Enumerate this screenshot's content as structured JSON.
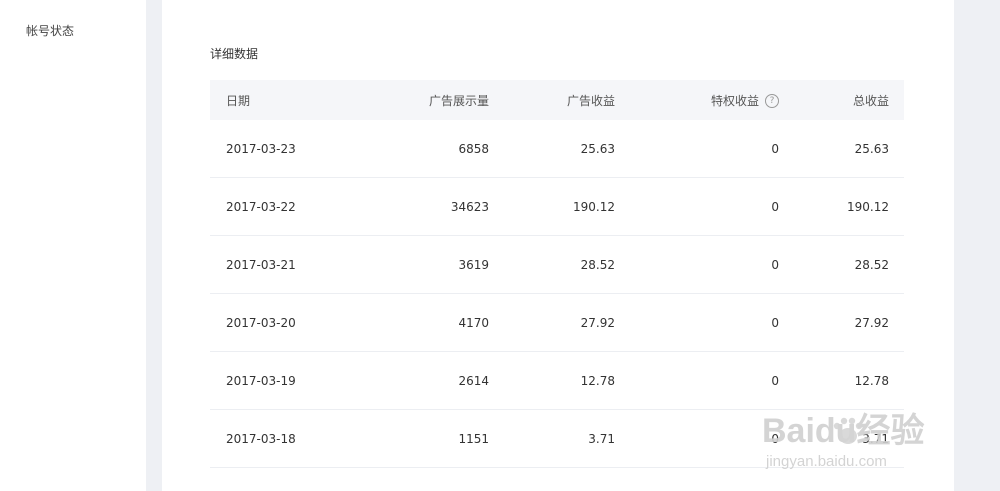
{
  "sidebar": {
    "items": [
      {
        "label": "帐号状态"
      }
    ]
  },
  "main": {
    "section_title": "详细数据",
    "table": {
      "headers": {
        "date": "日期",
        "impressions": "广告展示量",
        "ad_revenue": "广告收益",
        "privilege_revenue": "特权收益",
        "total_revenue": "总收益"
      },
      "rows": [
        {
          "date": "2017-03-23",
          "impressions": "6858",
          "ad_revenue": "25.63",
          "privilege_revenue": "0",
          "total_revenue": "25.63"
        },
        {
          "date": "2017-03-22",
          "impressions": "34623",
          "ad_revenue": "190.12",
          "privilege_revenue": "0",
          "total_revenue": "190.12"
        },
        {
          "date": "2017-03-21",
          "impressions": "3619",
          "ad_revenue": "28.52",
          "privilege_revenue": "0",
          "total_revenue": "28.52"
        },
        {
          "date": "2017-03-20",
          "impressions": "4170",
          "ad_revenue": "27.92",
          "privilege_revenue": "0",
          "total_revenue": "27.92"
        },
        {
          "date": "2017-03-19",
          "impressions": "2614",
          "ad_revenue": "12.78",
          "privilege_revenue": "0",
          "total_revenue": "12.78"
        },
        {
          "date": "2017-03-18",
          "impressions": "1151",
          "ad_revenue": "3.71",
          "privilege_revenue": "0",
          "total_revenue": "3.71"
        }
      ]
    },
    "help_icon_glyph": "?"
  },
  "watermark": {
    "brand": "Baidu经验",
    "url": "jingyan.baidu.com"
  },
  "colors": {
    "background": "#eef0f4",
    "panel": "#ffffff",
    "header_row": "#f5f6f9"
  }
}
